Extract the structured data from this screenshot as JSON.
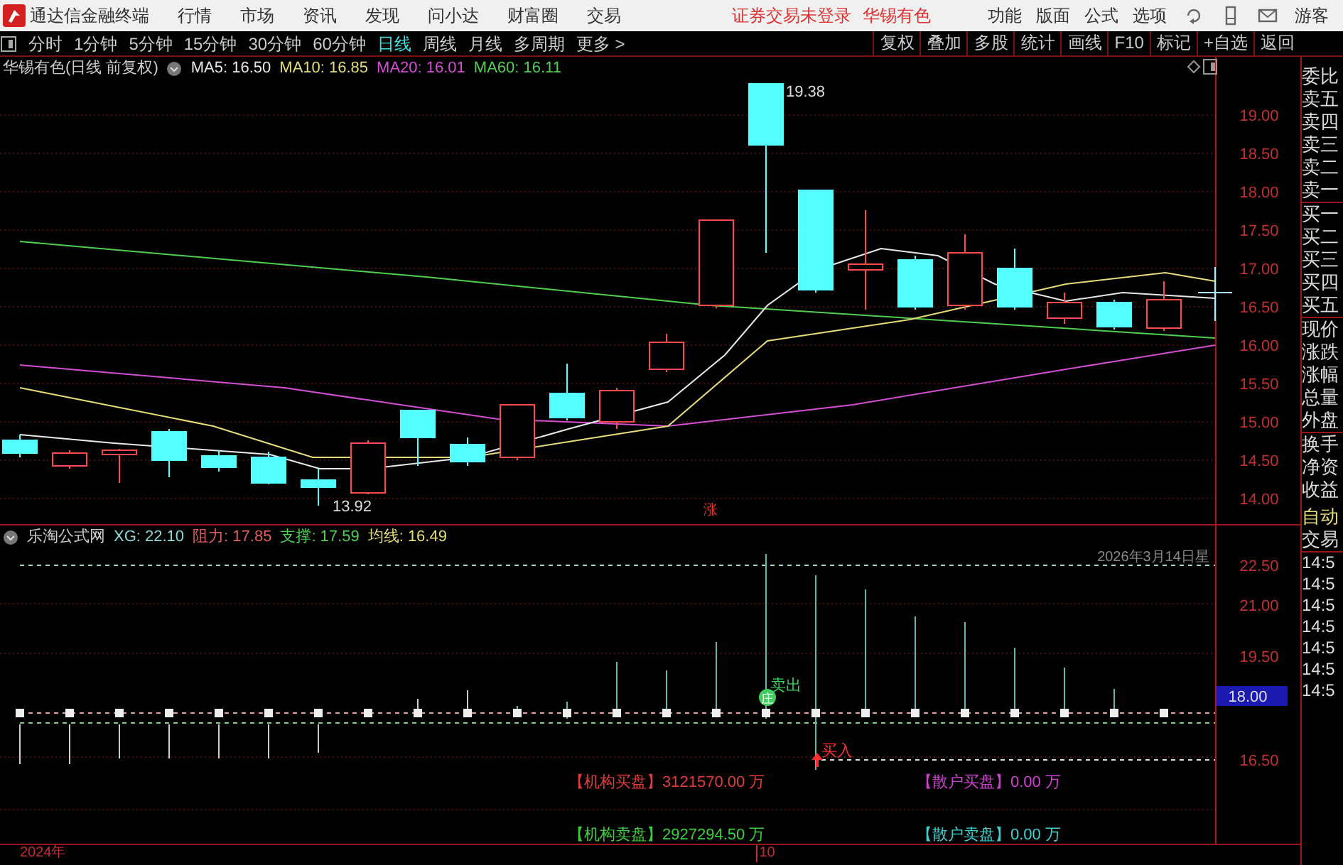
{
  "app": {
    "title": "通达信金融终端"
  },
  "menu": [
    "行情",
    "市场",
    "资讯",
    "发现",
    "问小达",
    "财富圈",
    "交易"
  ],
  "login_status": "证券交易未登录",
  "stock_name": "华锡有色",
  "right_menu": [
    "功能",
    "版面",
    "公式",
    "选项"
  ],
  "user": "游客",
  "periods": [
    {
      "label": "分时",
      "selected": false
    },
    {
      "label": "1分钟",
      "selected": false
    },
    {
      "label": "5分钟",
      "selected": false
    },
    {
      "label": "15分钟",
      "selected": false
    },
    {
      "label": "30分钟",
      "selected": false
    },
    {
      "label": "60分钟",
      "selected": false
    },
    {
      "label": "日线",
      "selected": true
    },
    {
      "label": "周线",
      "selected": false
    },
    {
      "label": "月线",
      "selected": false
    },
    {
      "label": "多周期",
      "selected": false
    },
    {
      "label": "更多 >",
      "selected": false
    }
  ],
  "tools": [
    "复权",
    "叠加",
    "多股",
    "统计",
    "画线",
    "F10",
    "标记",
    "+自选",
    "返回"
  ],
  "main_chart": {
    "title": "华锡有色(日线 前复权)",
    "indicators": [
      {
        "label": "MA5: 16.50",
        "color": "#e8e8e8"
      },
      {
        "label": "MA10: 16.85",
        "color": "#e6dc78"
      },
      {
        "label": "MA20: 16.01",
        "color": "#d24fd2"
      },
      {
        "label": "MA60: 16.11",
        "color": "#4fcf4f"
      }
    ],
    "high_label": "19.38",
    "low_label": "13.92",
    "limit_mark": "涨",
    "price_axis": [
      "19.00",
      "18.50",
      "18.00",
      "17.50",
      "17.00",
      "16.50",
      "16.00",
      "15.50",
      "15.00",
      "14.50",
      "14.00"
    ]
  },
  "indicator_chart": {
    "title": "乐淘公式网",
    "values": [
      {
        "label": "XG: 22.10",
        "color": "#8fd6d6"
      },
      {
        "label": "阻力: 17.85",
        "color": "#e06060"
      },
      {
        "label": "支撑: 17.59",
        "color": "#4fcf4f"
      },
      {
        "label": "均线: 16.49",
        "color": "#e6dc78"
      }
    ],
    "date_text": "2026年3月14日星",
    "axis": [
      "22.50",
      "21.00",
      "19.50",
      "16.50"
    ],
    "current": "18.00",
    "sell_signal": {
      "badge": "庄",
      "label": "卖出"
    },
    "buy_signal": "买入",
    "flows": [
      {
        "label": "【机构买盘】3121570.00 万",
        "color": "#e03c3c"
      },
      {
        "label": "【散户买盘】0.00 万",
        "color": "#d040d0"
      },
      {
        "label": "【机构卖盘】2927294.50 万",
        "color": "#3ccf3c"
      },
      {
        "label": "【散户卖盘】0.00 万",
        "color": "#40d0d0"
      }
    ]
  },
  "time_axis": [
    "2024年",
    "10"
  ],
  "quote_labels": [
    "委比",
    "卖五",
    "卖四",
    "卖三",
    "卖二",
    "卖一",
    "买一",
    "买二",
    "买三",
    "买四",
    "买五",
    "现价",
    "涨跌",
    "涨幅",
    "总量",
    "外盘",
    "换手",
    "净资",
    "收益"
  ],
  "auto_trade": [
    "自动",
    "交易"
  ],
  "times": [
    "14:5",
    "14:5",
    "14:5",
    "14:5",
    "14:5",
    "14:5",
    "14:5"
  ]
}
